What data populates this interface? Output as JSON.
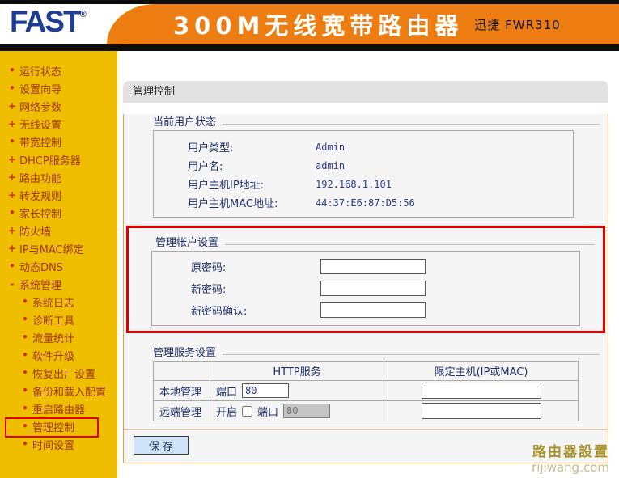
{
  "header": {
    "logo": "FAST",
    "logo_reg": "®",
    "title": "300M无线宽带路由器",
    "model": "迅捷 FWR310"
  },
  "sidebar": {
    "items": [
      {
        "bullet": "•",
        "label": "运行状态"
      },
      {
        "bullet": "•",
        "label": "设置向导"
      },
      {
        "bullet": "+",
        "label": "网络参数"
      },
      {
        "bullet": "+",
        "label": "无线设置"
      },
      {
        "bullet": "•",
        "label": "带宽控制"
      },
      {
        "bullet": "+",
        "label": "DHCP服务器"
      },
      {
        "bullet": "+",
        "label": "路由功能"
      },
      {
        "bullet": "+",
        "label": "转发规则"
      },
      {
        "bullet": "•",
        "label": "家长控制"
      },
      {
        "bullet": "+",
        "label": "防火墙"
      },
      {
        "bullet": "+",
        "label": "IP与MAC绑定"
      },
      {
        "bullet": "•",
        "label": "动态DNS"
      },
      {
        "bullet": "-",
        "label": "系统管理"
      },
      {
        "bullet": "•",
        "label": "系统日志"
      },
      {
        "bullet": "•",
        "label": "诊断工具"
      },
      {
        "bullet": "•",
        "label": "流量统计"
      },
      {
        "bullet": "•",
        "label": "软件升级"
      },
      {
        "bullet": "•",
        "label": "恢复出厂设置"
      },
      {
        "bullet": "•",
        "label": "备份和载入配置"
      },
      {
        "bullet": "•",
        "label": "重启路由器"
      },
      {
        "bullet": "•",
        "label": "管理控制"
      },
      {
        "bullet": "•",
        "label": "时间设置"
      }
    ]
  },
  "main": {
    "page_title": "管理控制",
    "user_status": {
      "title": "当前用户状态",
      "rows": [
        {
          "label": "用户类型:",
          "value": "Admin"
        },
        {
          "label": "用户名:",
          "value": "admin"
        },
        {
          "label": "用户主机IP地址:",
          "value": "192.168.1.101"
        },
        {
          "label": "用户主机MAC地址:",
          "value": "44:37:E6:87:D5:56"
        }
      ]
    },
    "account": {
      "title": "管理帐户设置",
      "old_password_label": "原密码:",
      "new_password_label": "新密码:",
      "confirm_password_label": "新密码确认:",
      "old_password_value": "",
      "new_password_value": "",
      "confirm_password_value": ""
    },
    "service": {
      "title": "管理服务设置",
      "col_http": "HTTP服务",
      "col_host": "限定主机(IP或MAC)",
      "local_label": "本地管理",
      "remote_label": "远端管理",
      "port_label": "端口",
      "enable_label": "开启",
      "local_port": "80",
      "remote_port": "80",
      "local_host": "",
      "remote_host": ""
    },
    "save_label": "保 存"
  },
  "footer": {
    "brand": "路由器設置",
    "site": "rijiwang.com"
  },
  "colors": {
    "header_orange": "#ED7D11",
    "logo_blue": "#1E3E96",
    "sidebar_gold": "#EFBE00",
    "sidebar_text": "#A03500",
    "highlight_red": "#DD0000",
    "panel_border_orange": "#E8A43F",
    "label_navy": "#1F2F66",
    "value_navy": "#2B3C8F",
    "save_button_blue": "#CFE3F8",
    "watermark_brand": "#A8922E",
    "watermark_site": "#C6BB8D"
  }
}
